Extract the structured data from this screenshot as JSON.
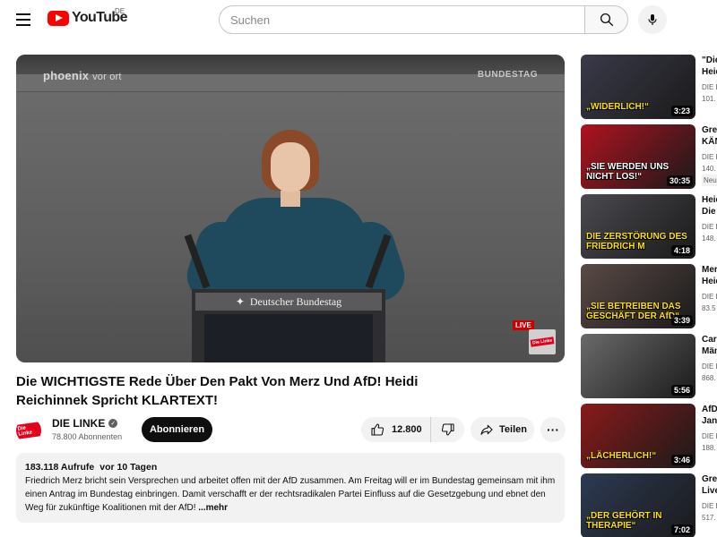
{
  "header": {
    "logo_text": "YouTube",
    "region": "DE",
    "search_placeholder": "Suchen",
    "icons": [
      "menu-icon",
      "search-icon",
      "mic-icon"
    ]
  },
  "player": {
    "watermark_left": "phoenix",
    "watermark_left_suffix": "vor ort",
    "watermark_right": "BUNDESTAG",
    "lectern_text": "Deutscher Bundestag",
    "live_label": "LIVE",
    "corner_logo": "Die Linke"
  },
  "video": {
    "title": "Die WICHTIGSTE Rede Über Den Pakt Von Merz Und AfD! Heidi Reichinnek Spricht KLARTEXT!",
    "channel_name": "DIE LINKE",
    "channel_avatar_text": "Die Linke",
    "subscribers": "78.800 Abonnenten",
    "subscribe_label": "Abonnieren",
    "likes": "12.800",
    "share_label": "Teilen",
    "more_label": "···",
    "views": "183.118 Aufrufe",
    "age": "vor 10 Tagen",
    "description": "Friedrich Merz bricht sein Versprechen und arbeitet offen mit der AfD zusammen. Am Freitag will er im Bundestag gemeinsam mit ihm einen Antrag im Bundestag einbringen. Damit verschafft er der rechtsradikalen Partei Einfluss auf die Gesetzgebung und ebnet den Weg für zukünftige Koalitionen mit der AfD!",
    "more_text": "...mehr"
  },
  "recommendations": [
    {
      "caption": "„WIDERLICH!“",
      "caption_color": "yellow",
      "duration": "3:23",
      "title1": "\"Die",
      "title2": "Heid",
      "channel": "DIE L",
      "stats": "101.",
      "badge": "",
      "bg": "#3a3a4a"
    },
    {
      "caption": "„SIE WERDEN UNS NICHT LOS!“",
      "caption_color": "white",
      "duration": "30:35",
      "title1": "Greg",
      "title2": "KÄN",
      "channel": "DIE L",
      "stats": "140.",
      "badge": "Neu",
      "bg": "#b0121f"
    },
    {
      "caption": "DIE ZERSTÖRUNG DES FRIEDRICH M",
      "caption_color": "yellow",
      "duration": "4:18",
      "title1": "Heid",
      "title2": "Die",
      "channel": "DIE L",
      "stats": "148.",
      "badge": "",
      "bg": "#4a4a50"
    },
    {
      "caption": "„SIE BETREIBEN DAS GESCHÄFT DER AfD“",
      "caption_color": "yellow",
      "duration": "3:39",
      "title1": "Merz",
      "title2": "Heid",
      "channel": "DIE L",
      "stats": "83.5",
      "badge": "",
      "bg": "#5a4a46"
    },
    {
      "caption": "",
      "caption_color": "white",
      "duration": "5:56",
      "title1": "Caro",
      "title2": "Män",
      "channel": "DIE L",
      "stats": "868.",
      "badge": "",
      "bg": "#6a6a6a"
    },
    {
      "caption": "„LÄCHERLICH!“",
      "caption_color": "yellow",
      "duration": "3:46",
      "title1": "AfD",
      "title2": "Jan",
      "channel": "DIE L",
      "stats": "188.",
      "badge": "",
      "bg": "#8a1a1a"
    },
    {
      "caption": "„DER GEHÖRT IN THERAPIE“",
      "caption_color": "yellow",
      "duration": "7:02",
      "title1": "Greg",
      "title2": "Live",
      "channel": "DIE L",
      "stats": "517.",
      "badge": "",
      "bg": "#2c3a52"
    }
  ]
}
